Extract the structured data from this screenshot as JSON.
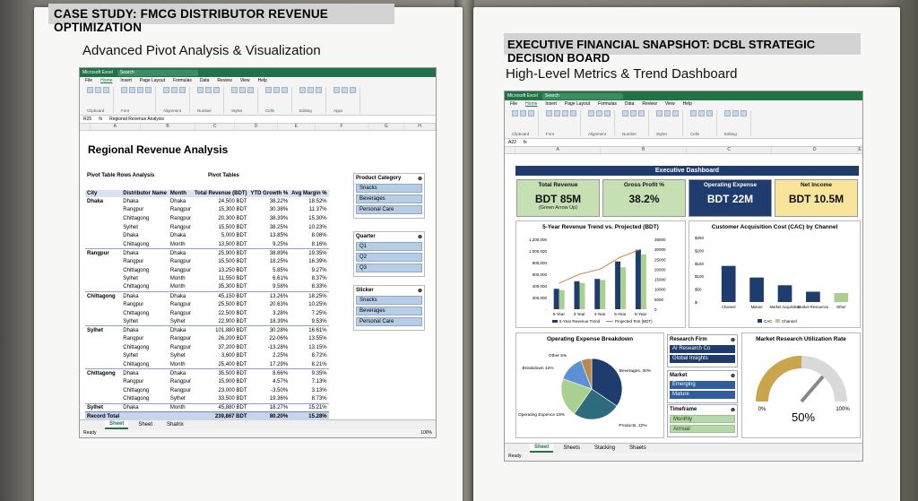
{
  "left": {
    "case_title": "CASE STUDY: FMCG DISTRIBUTOR REVENUE OPTIMIZATION",
    "subtitle": "Advanced Pivot Analysis & Visualization",
    "excel": {
      "app": "Microsoft Excel",
      "search": "Search",
      "menu": [
        "File",
        "Home",
        "Insert",
        "Page Layout",
        "Formulas",
        "Data",
        "Review",
        "View",
        "Help"
      ],
      "ribbon_groups": [
        "Clipboard",
        "Font",
        "Alignment",
        "Number",
        "Styles",
        "Cells",
        "Editing",
        "Apps"
      ],
      "font_name": "Calibri",
      "number_format": "General",
      "cell_ref": "R25",
      "formula": "Regional Revenue Analysis",
      "share": "Share",
      "comments": "Comments",
      "columns": [
        "A",
        "B",
        "C",
        "D",
        "E",
        "F",
        "G",
        "H"
      ]
    },
    "sheet_title": "Regional Revenue Analysis",
    "pivot_rows_label": "Pivot Table Rows Analysis",
    "pivot_tables_label": "Pivot Tables",
    "headers": [
      "City",
      "Distributor Name",
      "Month",
      "Total Revenue (BDT)",
      "YTD Growth %",
      "Avg Margin %"
    ],
    "rows": [
      [
        "Dhaka",
        "Dhaka",
        "Dhaka",
        "24,500 BDT",
        "38.22%",
        "18.52%"
      ],
      [
        "",
        "Rangpur",
        "Rangpur",
        "15,300 BDT",
        "30.38%",
        "11.37%"
      ],
      [
        "",
        "Chittagong",
        "Rangpur",
        "20,300 BDT",
        "38.39%",
        "15.30%"
      ],
      [
        "",
        "Sylhet",
        "Rangpur",
        "15,500 BDT",
        "38.25%",
        "10.23%"
      ],
      [
        "",
        "Dhaka",
        "Dhaka",
        "5,000 BDT",
        "13.85%",
        "8.08%"
      ],
      [
        "",
        "Chittagong",
        "Month",
        "13,500 BDT",
        "9.25%",
        "8.16%"
      ],
      [
        "Rangpur",
        "Dhaka",
        "Dhaka",
        "25,900 BDT",
        "38.89%",
        "19.35%"
      ],
      [
        "",
        "Rangpur",
        "Rangpur",
        "15,500 BDT",
        "18.25%",
        "16.39%"
      ],
      [
        "",
        "Chittagong",
        "Rangpur",
        "13,250 BDT",
        "5.85%",
        "9.27%"
      ],
      [
        "",
        "Sylhet",
        "Month",
        "11,550 BDT",
        "6.61%",
        "8.37%"
      ],
      [
        "",
        "Chittagong",
        "Month",
        "35,300 BDT",
        "9.58%",
        "8.33%"
      ],
      [
        "Chittagong",
        "Dhaka",
        "Dhaka",
        "45,150 BDT",
        "13.26%",
        "18.25%"
      ],
      [
        "",
        "Rangpur",
        "Rangpur",
        "25,500 BDT",
        "20.63%",
        "10.25%"
      ],
      [
        "",
        "Chittagong",
        "Rangpur",
        "22,500 BDT",
        "3.28%",
        "7.25%"
      ],
      [
        "",
        "Sylhet",
        "Sylhet",
        "22,900 BDT",
        "18.39%",
        "9.53%"
      ],
      [
        "Sylhet",
        "Dhaka",
        "Dhaka",
        "101,880 BDT",
        "30.28%",
        "16.61%"
      ],
      [
        "",
        "Rangpur",
        "Rangpur",
        "26,200 BDT",
        "22-06%",
        "13.55%"
      ],
      [
        "",
        "Chittagong",
        "Rangpur",
        "37,200 BDT",
        "-13.28%",
        "13.15%"
      ],
      [
        "",
        "Sylhet",
        "Sylhet",
        "3,600 BDT",
        "2.25%",
        "8.72%"
      ],
      [
        "",
        "Chittagong",
        "Month",
        "25,400 BDT",
        "17.29%",
        "8.21%"
      ],
      [
        "Chittagong",
        "Dhaka",
        "Dhaka",
        "35,500 BDT",
        "8.66%",
        "9.35%"
      ],
      [
        "",
        "Rangpur",
        "Rangpur",
        "15,900 BDT",
        "4.57%",
        "7.13%"
      ],
      [
        "",
        "Chittagong",
        "Rangpur",
        "23,000 BDT",
        "-3.50%",
        "3.13%"
      ],
      [
        "",
        "Chittagong",
        "Sylhet",
        "33,500 BDT",
        "19.36%",
        "8.73%"
      ],
      [
        "Sylhet",
        "Dhaka",
        "Month",
        "45,880 BDT",
        "18.27%",
        "15.21%"
      ]
    ],
    "total_row": [
      "Record Total",
      "",
      "",
      "239,867 BDT",
      "80.20%",
      "15.28%"
    ],
    "slicers": [
      {
        "title": "Product Category",
        "items": [
          "Snacks",
          "Beverages",
          "Personal Care"
        ]
      },
      {
        "title": "Quarter",
        "items": [
          "Q1",
          "Q2",
          "Q3"
        ]
      },
      {
        "title": "Slicker",
        "items": [
          "Snacks",
          "Beverages",
          "Personal Care"
        ]
      }
    ],
    "tabs": [
      "Sheet",
      "Sheet",
      "Shatrix"
    ],
    "status_left": "Ready",
    "zoom": "100%"
  },
  "right": {
    "title": "EXECUTIVE FINANCIAL SNAPSHOT: DCBL STRATEGIC DECISION BOARD",
    "subtitle": "High-Level Metrics & Trend Dashboard",
    "excel": {
      "app": "Microsoft Excel",
      "search": "Search",
      "menu": [
        "File",
        "Home",
        "Insert",
        "Page Layout",
        "Formulas",
        "Data",
        "Review",
        "View",
        "Help"
      ],
      "ribbon_groups": [
        "Clipboard",
        "Font",
        "Alignment",
        "Number",
        "Styles",
        "Cells",
        "Editing"
      ],
      "font_name": "Calibri",
      "number_format": "General",
      "cell_ref": "A22",
      "share": "Share",
      "comments": "Comment",
      "columns": [
        "A",
        "B",
        "C",
        "D",
        "E"
      ]
    },
    "dashboard_title": "Executive Dashboard",
    "kpis": [
      {
        "label": "Total Revenue",
        "value": "BDT 85M",
        "note": "(Green Arrow Up)",
        "bg": "#c6e0b4"
      },
      {
        "label": "Gross Profit %",
        "value": "38.2%",
        "note": "",
        "bg": "#c6e0b4"
      },
      {
        "label": "Operating Expense",
        "value": "BDT 22M",
        "note": "",
        "bg": "#1f3c6e"
      },
      {
        "label": "Net Income",
        "value": "BDT 10.5M",
        "note": "",
        "bg": "#f8e59b"
      }
    ],
    "trend_title": "5-Year Revenue Trend vs. Projected (BDT)",
    "cac_title": "Customer Acquisition Cost (CAC) by Channel",
    "pie_title": "Operating Expense Breakdown",
    "gauge_title": "Market Research Utilization Rate",
    "gauge_min": "0%",
    "gauge_max": "100%",
    "gauge_value": "50%",
    "research_slicers": [
      {
        "title": "Research Firm",
        "items": [
          "AI Research Co",
          "Global Insights"
        ],
        "style": "navy"
      },
      {
        "title": "Market",
        "items": [
          "Emerging",
          "Mature"
        ],
        "style": "blue"
      },
      {
        "title": "Timeframe",
        "items": [
          "Monthly",
          "Annual"
        ],
        "style": "green"
      }
    ],
    "tabs": [
      "Sheet",
      "Sheets",
      "Stacking",
      "Shaets"
    ],
    "status_left": "Ready"
  },
  "chart_data": [
    {
      "type": "bar",
      "title": "5-Year Revenue Trend vs. Projected (BDT)",
      "categories": [
        "5-Year",
        "3-Year",
        "4-Year",
        "5-Year",
        "5-Year"
      ],
      "ylim": [
        0,
        1200000
      ],
      "y_ticks": [
        "1,200,000",
        "1,000,000",
        "800,000",
        "600,000",
        "400,000",
        "200,000",
        "-"
      ],
      "y2lim": [
        0,
        35000
      ],
      "y2_ticks": [
        "35000",
        "30000",
        "25000",
        "20000",
        "15000",
        "10000",
        "5000",
        "0"
      ],
      "series": [
        {
          "name": "5-Year Revenue Trend",
          "values": [
            350000,
            480000,
            520000,
            820000,
            1020000
          ],
          "color": "#1f3c6e"
        },
        {
          "name": "",
          "values": [
            330000,
            450000,
            500000,
            720000,
            940000
          ],
          "color": "#a9d08e"
        },
        {
          "name": "Projected Test (BDT)",
          "values": [
            13000,
            17500,
            20000,
            26000,
            30000
          ],
          "color": "#b98a4a",
          "kind": "line"
        }
      ]
    },
    {
      "type": "bar",
      "title": "Customer Acquisition Cost (CAC) by Channel",
      "categories": [
        "Channel",
        "Mature",
        "Market Acquisition",
        "Market Resources",
        "Other"
      ],
      "ylim": [
        0,
        250
      ],
      "y_ticks": [
        "$250",
        "$200",
        "$150",
        "$100",
        "$50",
        "$-"
      ],
      "series": [
        {
          "name": "CAC",
          "values": [
            140,
            95,
            65,
            40,
            0
          ],
          "color": "#1f3c6e"
        },
        {
          "name": "Channel",
          "values": [
            0,
            0,
            0,
            0,
            35
          ],
          "color": "#a9d08e"
        }
      ]
    },
    {
      "type": "pie",
      "title": "Operating Expense Breakdown",
      "categories": [
        "Beverages",
        "Products",
        "Operating Expence",
        "Breakdown",
        "Other"
      ],
      "values": [
        30,
        22,
        18,
        12,
        5
      ],
      "labels": [
        "Beverages, 30%",
        "Products, 22%",
        "Operating Expence 18%",
        "Breakdown 12%",
        "Other 5%"
      ],
      "colors": [
        "#1f3c6e",
        "#2e6b7e",
        "#a9d08e",
        "#5b8fd6",
        "#b98a4a"
      ]
    }
  ]
}
